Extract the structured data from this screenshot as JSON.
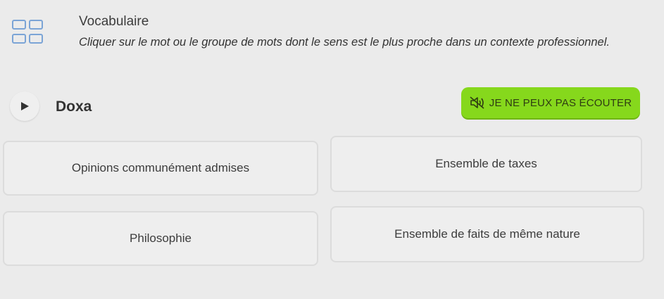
{
  "header": {
    "icon": "grid-icon",
    "title": "Vocabulaire",
    "instruction": "Cliquer sur le mot ou le groupe de mots dont le sens est le plus proche dans un contexte professionnel."
  },
  "question": {
    "play_icon": "play-icon",
    "word": "Doxa"
  },
  "cant_listen": {
    "icon": "speaker-muted-icon",
    "label": "JE NE PEUX PAS ÉCOUTER",
    "color": "#86d81c"
  },
  "options": [
    {
      "label": "Opinions communément admises"
    },
    {
      "label": "Ensemble de taxes"
    },
    {
      "label": "Philosophie"
    },
    {
      "label": "Ensemble de faits de même nature"
    }
  ]
}
